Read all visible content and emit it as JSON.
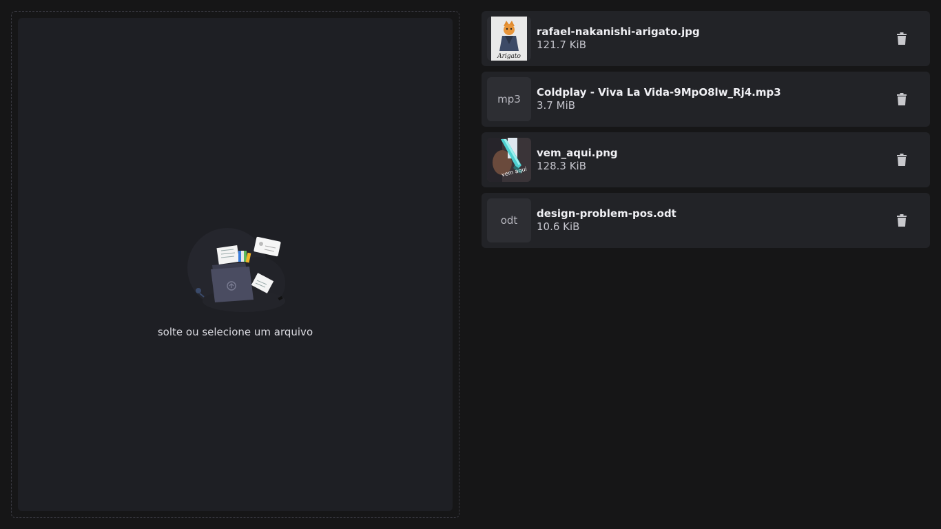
{
  "dropzone": {
    "label": "solte ou selecione um arquivo",
    "illustration_icon": "upload-folder-illustration"
  },
  "files": [
    {
      "name": "rafael-nakanishi-arigato.jpg",
      "size": "121.7 KiB",
      "thumb_type": "image",
      "thumb_text": "Arigato",
      "delete_icon": "trash-icon"
    },
    {
      "name": "Coldplay - Viva La Vida-9MpO8lw_Rj4.mp3",
      "size": "3.7 MiB",
      "thumb_type": "extension",
      "thumb_text": "mp3",
      "delete_icon": "trash-icon"
    },
    {
      "name": "vem_aqui.png",
      "size": "128.3 KiB",
      "thumb_type": "image",
      "thumb_text": "vem aqui",
      "delete_icon": "trash-icon"
    },
    {
      "name": "design-problem-pos.odt",
      "size": "10.6 KiB",
      "thumb_type": "extension",
      "thumb_text": "odt",
      "delete_icon": "trash-icon"
    }
  ],
  "colors": {
    "background": "#161617",
    "panel": "#1e1f24",
    "card": "#222327",
    "thumb_bg": "#2d2e33",
    "icon": "#c8c8cc"
  }
}
